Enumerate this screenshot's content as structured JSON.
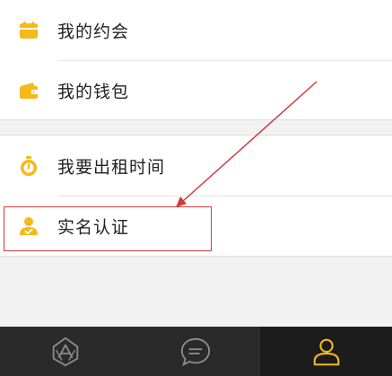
{
  "menu": {
    "group1": [
      {
        "label": "我的约会",
        "icon": "calendar-icon"
      },
      {
        "label": "我的钱包",
        "icon": "wallet-icon"
      }
    ],
    "group2": [
      {
        "label": "我要出租时间",
        "icon": "stopwatch-icon"
      },
      {
        "label": "实名认证",
        "icon": "verified-user-icon"
      }
    ]
  },
  "tabbar": {
    "tabs": [
      {
        "icon": "home-logo-icon",
        "active": false
      },
      {
        "icon": "chat-bubble-icon",
        "active": false
      },
      {
        "icon": "profile-icon",
        "active": true
      }
    ]
  },
  "colors": {
    "accent": "#f5b91c",
    "annotation": "#d23a3a",
    "tabbar_bg": "#2a2a2a",
    "page_bg": "#f2f2f2"
  }
}
